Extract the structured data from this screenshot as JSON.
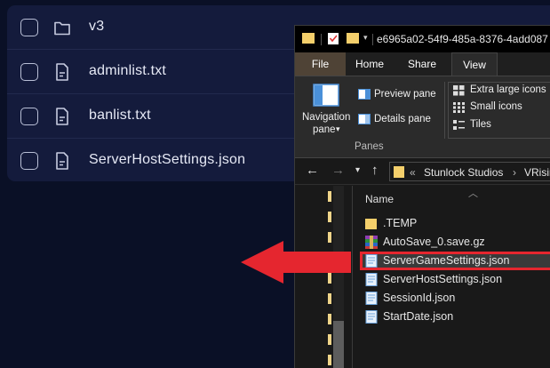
{
  "web_panel": {
    "rows": [
      {
        "label": "v3",
        "icon": "folder-icon"
      },
      {
        "label": "adminlist.txt",
        "icon": "document-icon"
      },
      {
        "label": "banlist.txt",
        "icon": "document-icon"
      },
      {
        "label": "ServerHostSettings.json",
        "icon": "document-icon"
      }
    ]
  },
  "explorer": {
    "title": "e6965a02-54f9-485a-8376-4add087",
    "tabs": {
      "file": "File",
      "home": "Home",
      "share": "Share",
      "view": "View"
    },
    "ribbon": {
      "navigation_pane_line1": "Navigation",
      "navigation_pane_line2": "pane",
      "navigation_pane_caret": "▾",
      "preview_pane": "Preview pane",
      "details_pane": "Details pane",
      "group_label": "Panes",
      "extra_large_icons": "Extra large icons",
      "small_icons": "Small icons",
      "tiles": "Tiles"
    },
    "address": {
      "overflow": "«",
      "crumb1": "Stunlock Studios",
      "crumb_sep": "›",
      "crumb2": "VRisin"
    },
    "column_header": "Name",
    "files": [
      {
        "name": ".TEMP",
        "type": "folder"
      },
      {
        "name": "AutoSave_0.save.gz",
        "type": "archive"
      },
      {
        "name": "ServerGameSettings.json",
        "type": "json",
        "highlighted": true
      },
      {
        "name": "ServerHostSettings.json",
        "type": "json"
      },
      {
        "name": "SessionId.json",
        "type": "json"
      },
      {
        "name": "StartDate.json",
        "type": "json"
      }
    ]
  },
  "colors": {
    "highlight": "#e5262f",
    "arrow": "#e5262f",
    "web_bg": "#141b3c",
    "file_tab": "#4f4336"
  }
}
